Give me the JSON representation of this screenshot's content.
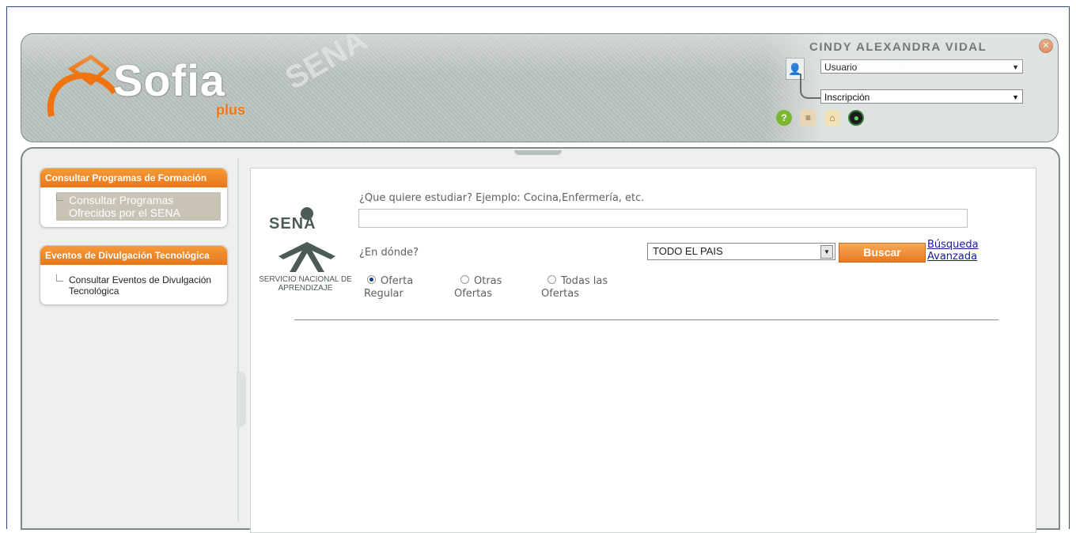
{
  "header": {
    "logo_main": "Sofia",
    "logo_sub": "plus",
    "watermark": "SENA",
    "user_name": "CINDY ALEXANDRA VIDAL",
    "role_select": "Usuario",
    "module_select": "Inscripción",
    "icons": [
      "help-icon",
      "book-icon",
      "lock-icon",
      "power-icon"
    ]
  },
  "sidebar": {
    "blocks": [
      {
        "title": "Consultar Programas de Formación",
        "items": [
          "Consultar Programas Ofrecidos por el SENA"
        ]
      },
      {
        "title": "Eventos de Divulgación Tecnológica",
        "items": [
          "Consultar Eventos de Divulgación Tecnológica"
        ]
      }
    ]
  },
  "search": {
    "logo_text": "SENA",
    "logo_org": "SERVICIO NACIONAL DE APRENDIZAJE",
    "what_label": "¿Que quiere estudiar? Ejemplo: Cocina,Enfermería, etc.",
    "what_value": "",
    "where_label": "¿En dónde?",
    "where_value": "TODO EL PAIS",
    "button": "Buscar",
    "advanced_link_1": "Búsqueda",
    "advanced_link_2": "Avanzada",
    "radios": [
      {
        "line1": "Oferta",
        "line2": "Regular",
        "checked": true
      },
      {
        "line1": "Otras",
        "line2": "Ofertas",
        "checked": false
      },
      {
        "line1": "Todas las",
        "line2": "Ofertas",
        "checked": false
      }
    ]
  },
  "colors": {
    "accent_orange": "#e8781e",
    "border_blue": "#2a4a82",
    "link": "#1a1aa0"
  }
}
